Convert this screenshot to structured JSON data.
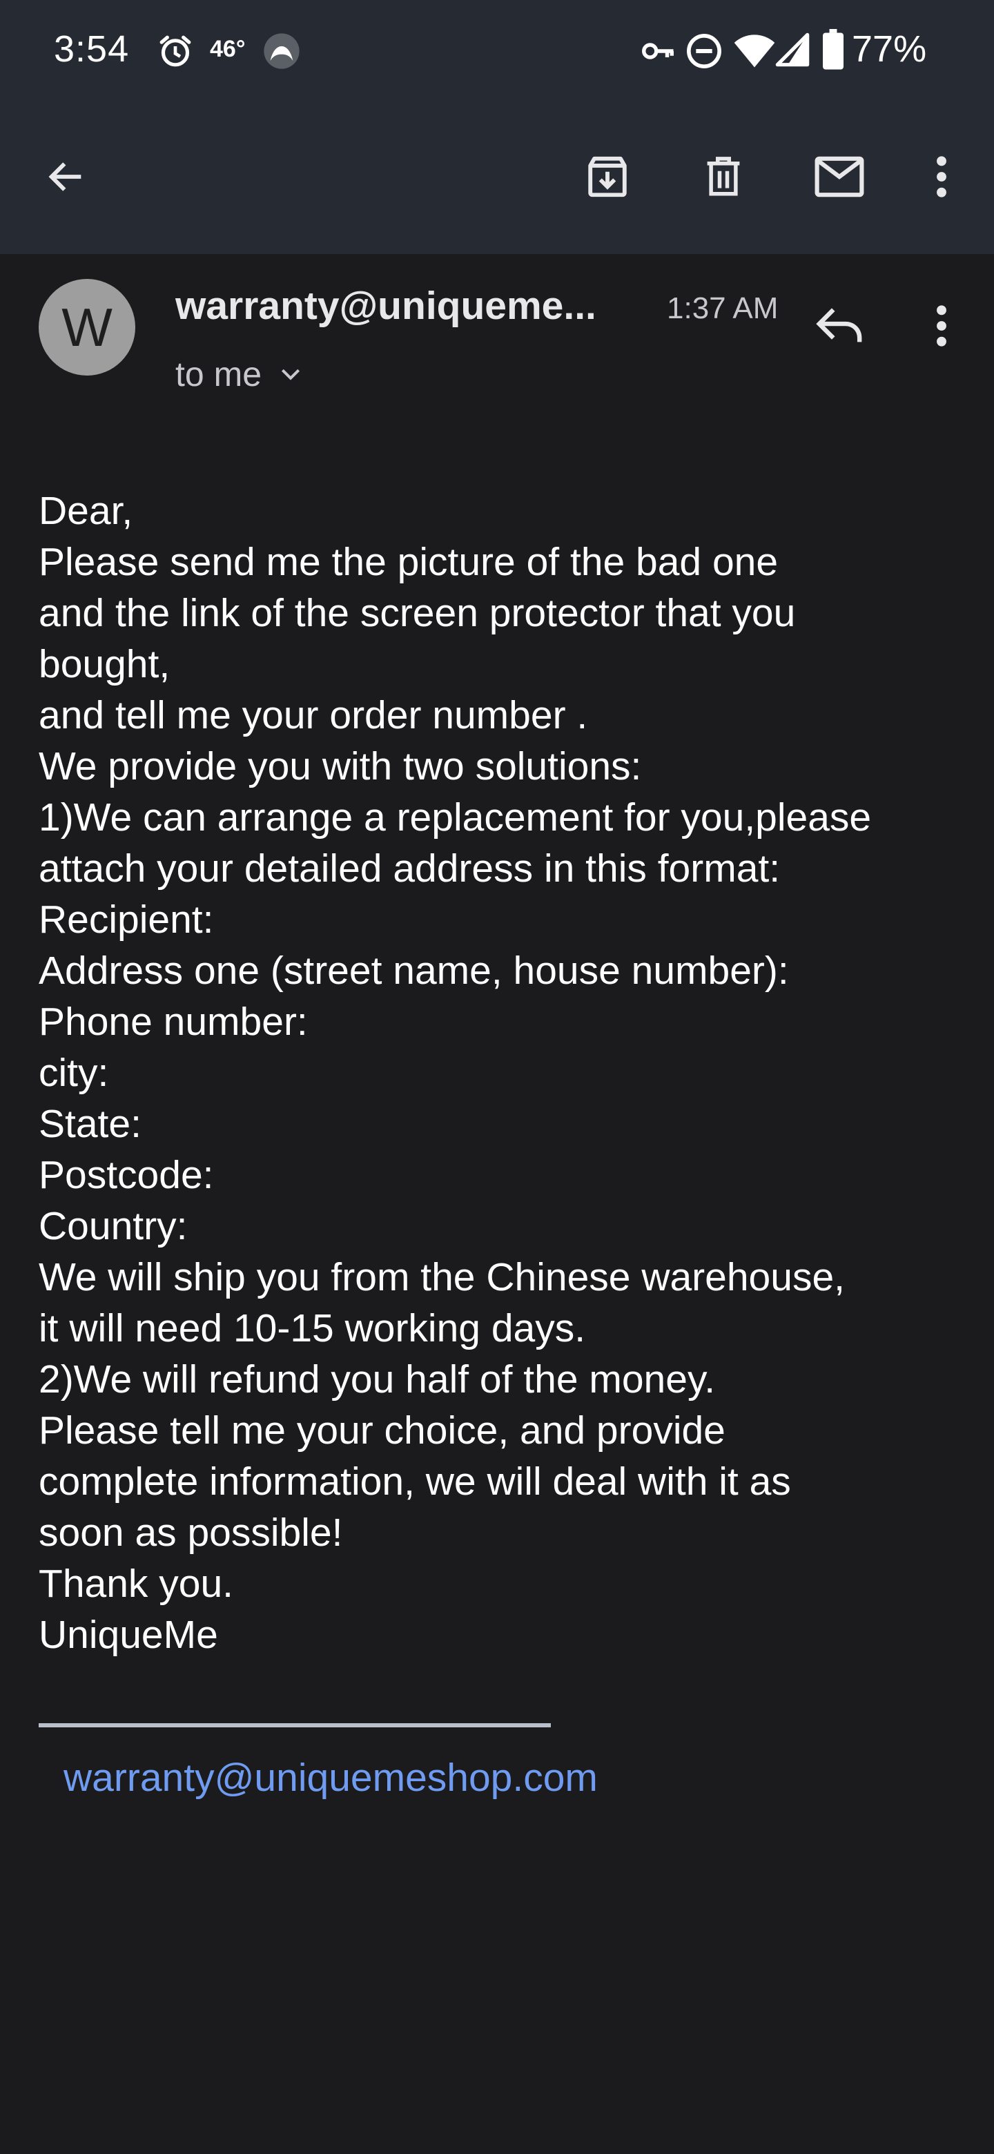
{
  "status_bar": {
    "time": "3:54",
    "temperature": "46°",
    "battery": "77%",
    "icons": [
      "alarm-icon",
      "weather-icon",
      "vpn-key-icon",
      "do-not-disturb-icon",
      "wifi-icon",
      "cell-signal-icon",
      "battery-icon"
    ]
  },
  "toolbar": {
    "icons": [
      "back-arrow-icon",
      "archive-icon",
      "delete-icon",
      "mark-unread-icon",
      "more-vert-icon"
    ]
  },
  "message": {
    "avatar_letter": "W",
    "sender": "warranty@uniqueme...",
    "time": "1:37 AM",
    "recipient": "to me",
    "body_lines": [
      "Dear,",
      "Please send me the picture of the bad one",
      "and the link of the screen protector that you",
      "bought,",
      "and tell me your order number .",
      "We provide you with two solutions:",
      "1)We can arrange a replacement for you,please",
      "attach your detailed address in this format:",
      "Recipient:",
      "Address one (street name, house number):",
      "Phone number:",
      "city:",
      "State:",
      "Postcode:",
      "Country:",
      "We will ship you from the Chinese warehouse,",
      "it will need 10-15 working days.",
      "2)We will refund you half of the money.",
      "Please tell me your choice, and provide",
      "complete information, we will deal with it as",
      "soon as possible!",
      "Thank you.",
      "UniqueMe"
    ],
    "signature_email": "warranty@uniquemeshop.com"
  },
  "colors": {
    "header_bg": "#262a33",
    "page_bg": "#1b1b1d",
    "link": "#6f9bf0",
    "avatar_bg": "#9e9e9e"
  }
}
